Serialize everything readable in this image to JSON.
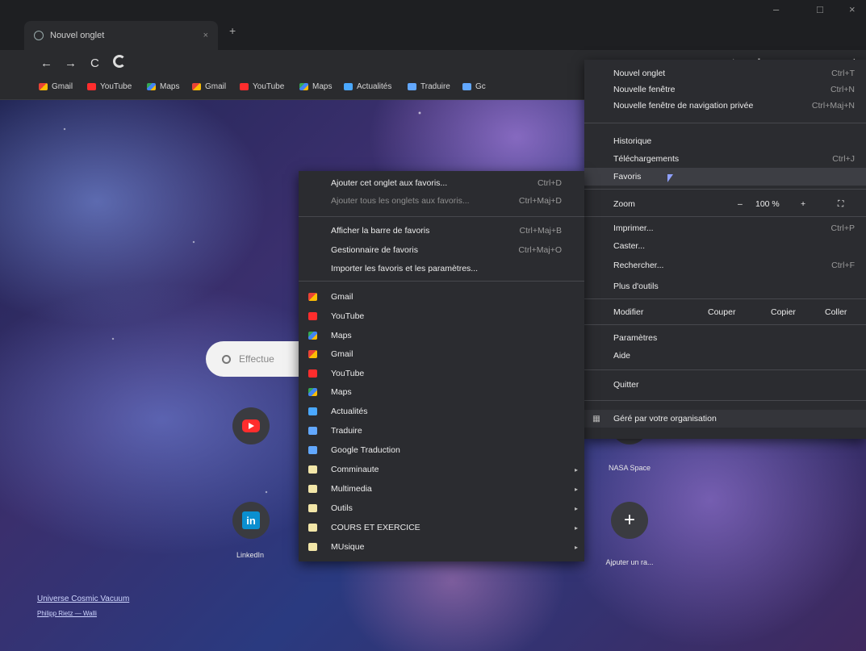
{
  "tab": {
    "title": "Nouvel onglet",
    "close": "×",
    "new": "+"
  },
  "window": {
    "min": "–",
    "max": "□",
    "close": "×"
  },
  "nav": {
    "back": "←",
    "forward": "→",
    "reload": "C"
  },
  "bookmarks_bar": [
    {
      "label": "Gmail",
      "icon": "gmail-icon"
    },
    {
      "label": "YouTube",
      "icon": "youtube-icon"
    },
    {
      "label": "Maps",
      "icon": "maps-icon"
    },
    {
      "label": "Gmail",
      "icon": "gmail-icon"
    },
    {
      "label": "YouTube",
      "icon": "youtube-icon"
    },
    {
      "label": "Maps",
      "icon": "maps-icon"
    },
    {
      "label": "Actualités",
      "icon": "news-icon"
    },
    {
      "label": "Traduire",
      "icon": "translate-icon"
    },
    {
      "label": "Gc",
      "icon": "translate-icon"
    }
  ],
  "search": {
    "placeholder": "Effectue"
  },
  "shortcuts": {
    "add_label": "Ajouter un ra...",
    "nasa_label": "NASA Space",
    "linkedin_label": "LinkedIn",
    "plus": "+"
  },
  "credit": {
    "title": "Universe Cosmic Vacuum",
    "author": "Philipp Rietz — Walli"
  },
  "main_menu": {
    "items": {
      "new_tab": {
        "label": "Nouvel onglet",
        "shortcut": "Ctrl+T"
      },
      "new_window": {
        "label": "Nouvelle fenêtre",
        "shortcut": "Ctrl+N"
      },
      "incognito": {
        "label": "Nouvelle fenêtre de navigation privée",
        "shortcut": "Ctrl+Maj+N"
      },
      "history": {
        "label": "Historique"
      },
      "downloads": {
        "label": "Téléchargements",
        "shortcut": "Ctrl+J"
      },
      "bookmarks": {
        "label": "Favoris"
      },
      "zoom": {
        "label": "Zoom",
        "minus": "–",
        "value": "100 %",
        "plus": "+",
        "fullscreen": "⛶"
      },
      "print": {
        "label": "Imprimer...",
        "shortcut": "Ctrl+P"
      },
      "cast": {
        "label": "Caster..."
      },
      "find": {
        "label": "Rechercher...",
        "shortcut": "Ctrl+F"
      },
      "more_tools": {
        "label": "Plus d'outils"
      },
      "edit": {
        "label": "Modifier",
        "cut": "Couper",
        "copy": "Copier",
        "paste": "Coller"
      },
      "settings": {
        "label": "Paramètres"
      },
      "help": {
        "label": "Aide"
      },
      "quit": {
        "label": "Quitter"
      },
      "managed": {
        "label": "Géré par votre organisation"
      }
    }
  },
  "bookmarks_menu": {
    "add_tab": {
      "label": "Ajouter cet onglet aux favoris...",
      "shortcut": "Ctrl+D"
    },
    "add_all": {
      "label": "Ajouter tous les onglets aux favoris...",
      "shortcut": "Ctrl+Maj+D"
    },
    "show_bar": {
      "label": "Afficher la barre de favoris",
      "shortcut": "Ctrl+Maj+B"
    },
    "manager": {
      "label": "Gestionnaire de favoris",
      "shortcut": "Ctrl+Maj+O"
    },
    "import": {
      "label": "Importer les favoris et les paramètres..."
    },
    "list": [
      {
        "label": "Gmail",
        "icon": "gmail-icon"
      },
      {
        "label": "YouTube",
        "icon": "youtube-icon"
      },
      {
        "label": "Maps",
        "icon": "maps-icon"
      },
      {
        "label": "Gmail",
        "icon": "gmail-icon"
      },
      {
        "label": "YouTube",
        "icon": "youtube-icon"
      },
      {
        "label": "Maps",
        "icon": "maps-icon"
      },
      {
        "label": "Actualités",
        "icon": "news-icon"
      },
      {
        "label": "Traduire",
        "icon": "translate-icon"
      },
      {
        "label": "Google Traduction",
        "icon": "translate-icon"
      },
      {
        "label": "Comminaute",
        "icon": "folder-icon",
        "submenu": "▸"
      },
      {
        "label": "Multimedia",
        "icon": "folder-icon",
        "submenu": "▸"
      },
      {
        "label": "Outils",
        "icon": "folder-icon",
        "submenu": "▸"
      },
      {
        "label": "COURS ET EXERCICE",
        "icon": "folder-icon",
        "submenu": "▸"
      },
      {
        "label": "MUsique",
        "icon": "folder-icon",
        "submenu": "▸"
      }
    ]
  }
}
